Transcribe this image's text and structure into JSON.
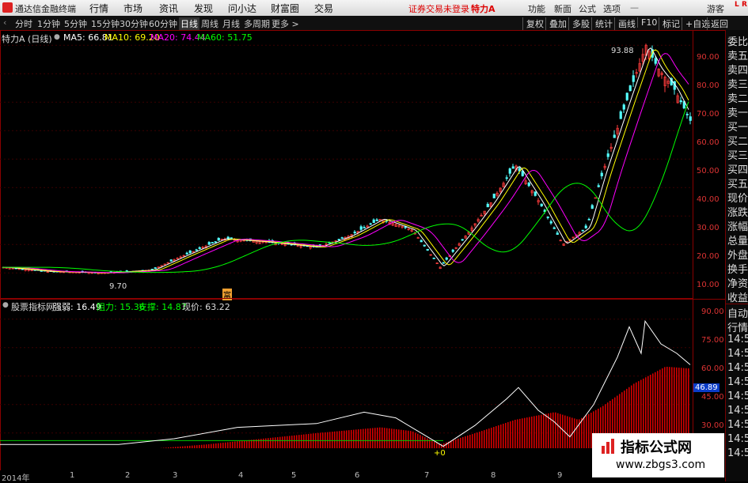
{
  "app": {
    "title": "通达信金融终端",
    "menus": [
      "行情",
      "市场",
      "资讯",
      "发现",
      "问小达",
      "财富圈",
      "交易"
    ],
    "status": "证券交易未登录",
    "stock": "特力A",
    "right_menus": [
      "功能",
      "新面",
      "公式",
      "选项"
    ],
    "guest": "游客",
    "corner_letter": "L",
    "corner_letter2": "R"
  },
  "toolbar": {
    "periods": [
      "分时",
      "1分钟",
      "5分钟",
      "15分钟",
      "30分钟",
      "60分钟",
      "日线",
      "周线",
      "月线",
      "多周期",
      "更多 >"
    ],
    "selected": "日线",
    "right_buttons": [
      "复权",
      "叠加",
      "多股",
      "统计",
      "画线",
      "F10",
      "标记",
      "+自选",
      "返回"
    ]
  },
  "main_chart": {
    "title": "特力A (日线)",
    "ma": [
      {
        "label": "MA5: 66.81",
        "color": "#ffffff"
      },
      {
        "label": "MA10: 69.20",
        "color": "#ffff00"
      },
      {
        "label": "MA20: 74.44",
        "color": "#ff00ff"
      },
      {
        "label": "MA60: 51.75",
        "color": "#00ff00"
      }
    ],
    "y_ticks": [
      "90.00",
      "80.00",
      "70.00",
      "60.00",
      "50.00",
      "40.00",
      "30.00",
      "20.00",
      "10.00"
    ],
    "high_label": "93.88",
    "low_label": "9.70",
    "marker": "富"
  },
  "sub_chart": {
    "title": "股票指标网",
    "items": [
      {
        "label": "强弱: 16.49",
        "color": "#ffffff"
      },
      {
        "label": "阻力: 15.36",
        "color": "#00ff00"
      },
      {
        "label": "支撑: 14.87",
        "color": "#00ff00"
      },
      {
        "label": "现价: 63.22",
        "color": "#dddddd"
      }
    ],
    "y_ticks": [
      "90.00",
      "75.00",
      "60.00",
      "45.00",
      "30.00"
    ],
    "current_tag": "46.89",
    "marker_label": "+0"
  },
  "x_axis": [
    "2014年",
    "1",
    "2",
    "3",
    "4",
    "5",
    "6",
    "7",
    "8",
    "9"
  ],
  "right_panel": {
    "top_items": [
      "委比",
      "卖五",
      "卖四",
      "卖三",
      "卖二",
      "卖一",
      "买一",
      "买二",
      "买三",
      "买四",
      "买五",
      "现价",
      "涨跌",
      "涨幅",
      "总量",
      "外盘",
      "换手",
      "净资",
      "收益"
    ],
    "bottom_items": [
      "自动",
      "行情",
      "14:5",
      "14:5",
      "14:5",
      "14:5",
      "14:5",
      "14:5",
      "14:5",
      "14:5",
      "14:5"
    ]
  },
  "watermark": {
    "line1": "指标公式网",
    "line2": "www.zbgs3.com"
  }
}
